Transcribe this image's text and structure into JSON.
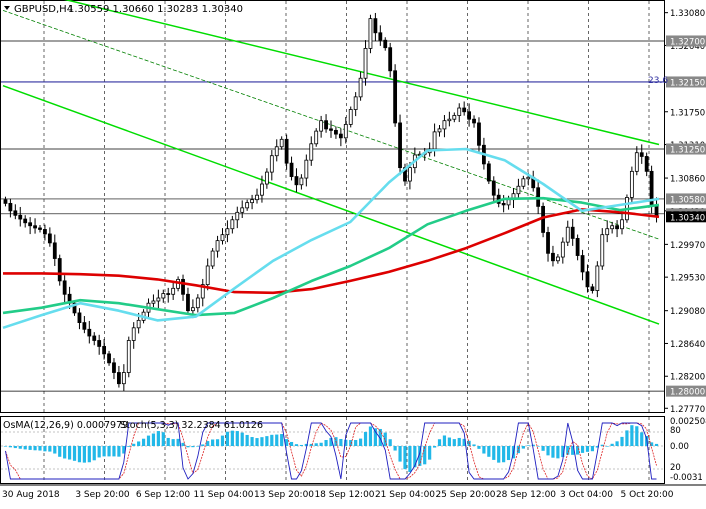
{
  "header": {
    "symbol": "GBPUSD,H4",
    "ohlc": "1.30559 1.30660 1.30283 1.30340"
  },
  "oscillator_header": {
    "osma_label": "OsMA(12,26,9) 0.0007979",
    "stoch_label": "Stoch(5,3,3) 32.2384 61.0126"
  },
  "price_axis": {
    "ticks": [
      "1.33080",
      "1.32640",
      "1.32150",
      "1.31750",
      "1.31310",
      "1.30860",
      "1.30420",
      "1.29970",
      "1.29530",
      "1.29080",
      "1.28640",
      "1.28200",
      "1.27770"
    ],
    "highlighted": [
      {
        "text": "1.32700",
        "value": 1.327,
        "kind": "level"
      },
      {
        "text": "1.32150",
        "value": 1.3215,
        "kind": "level-blue"
      },
      {
        "text": "1.31250",
        "value": 1.3125,
        "kind": "level"
      },
      {
        "text": "1.30580",
        "value": 1.3058,
        "kind": "level"
      },
      {
        "text": "1.30380",
        "value": 1.3038,
        "kind": "level"
      },
      {
        "text": "1.30340",
        "value": 1.3034,
        "kind": "current"
      },
      {
        "text": "1.28000",
        "value": 1.28,
        "kind": "level"
      }
    ],
    "fib_label": "23.6"
  },
  "osc_axis": {
    "ticks": [
      "0.002508",
      "80",
      "0.00",
      "20",
      "-0.0031"
    ]
  },
  "time_axis": {
    "labels": [
      "30 Aug 2018",
      "3 Sep 20:00",
      "6 Sep 12:00",
      "11 Sep 04:00",
      "13 Sep 20:00",
      "18 Sep 12:00",
      "21 Sep 04:00",
      "25 Sep 20:00",
      "28 Sep 12:00",
      "3 Oct 04:00",
      "5 Oct 20:00"
    ]
  },
  "colors": {
    "background": "#ffffff",
    "candle": "#000000",
    "channel": "#00dd00",
    "thin_channel": "#008000",
    "ema200": "#dd0000",
    "ema144": "#22cc88",
    "ema50": "#66ddee",
    "osma_hist": "#22b8e8",
    "stoch_main": "#1f1fbf",
    "stoch_signal": "#dd2222",
    "grid": "#000000",
    "level_blue": "#3030a0"
  },
  "chart_data": {
    "type": "candlestick",
    "title": "GBPUSD,H4",
    "ylim": [
      1.2772,
      1.3325
    ],
    "close_series": [
      1.3052,
      1.3042,
      1.3036,
      1.3031,
      1.3026,
      1.3022,
      1.3019,
      1.3017,
      1.3011,
      1.2999,
      1.2978,
      1.2948,
      1.293,
      1.2918,
      1.2905,
      1.2892,
      1.2883,
      1.2874,
      1.2868,
      1.286,
      1.285,
      1.2838,
      1.2825,
      1.281,
      1.2825,
      1.2868,
      1.2885,
      1.2895,
      1.2906,
      1.2918,
      1.2921,
      1.2925,
      1.2931,
      1.293,
      1.2938,
      1.295,
      1.293,
      1.2908,
      1.2912,
      1.2925,
      1.2943,
      1.2968,
      1.2988,
      1.3002,
      1.301,
      1.3018,
      1.303,
      1.304,
      1.3046,
      1.3053,
      1.3057,
      1.3063,
      1.3078,
      1.3094,
      1.3116,
      1.3128,
      1.3138,
      1.3106,
      1.3088,
      1.3077,
      1.3086,
      1.311,
      1.3132,
      1.3149,
      1.3163,
      1.3152,
      1.315,
      1.3145,
      1.314,
      1.3158,
      1.3178,
      1.3195,
      1.322,
      1.326,
      1.33,
      1.3281,
      1.3271,
      1.3261,
      1.323,
      1.316,
      1.31,
      1.3082,
      1.31,
      1.3117,
      1.3118,
      1.312,
      1.3125,
      1.3148,
      1.3152,
      1.3163,
      1.3165,
      1.317,
      1.318,
      1.3175,
      1.3165,
      1.316,
      1.313,
      1.3105,
      1.3082,
      1.3063,
      1.3052,
      1.305,
      1.3057,
      1.3065,
      1.3075,
      1.3085,
      1.3087,
      1.3073,
      1.3048,
      1.3013,
      1.2985,
      1.2975,
      1.298,
      1.3,
      1.302,
      1.3005,
      1.2982,
      1.296,
      1.294,
      1.2935,
      1.2968,
      1.301,
      1.3018,
      1.3022,
      1.3018,
      1.303,
      1.306,
      1.3095,
      1.312,
      1.3115,
      1.3095,
      1.305,
      1.3034
    ],
    "series": [
      {
        "name": "EMA200",
        "values": [
          1.2958,
          1.2958,
          1.2957,
          1.2955,
          1.295,
          1.2942,
          1.2933,
          1.2932,
          1.2937,
          1.2948,
          1.296,
          1.2975,
          1.2992,
          1.3012,
          1.3033,
          1.3044,
          1.304,
          1.3034
        ]
      },
      {
        "name": "EMA144",
        "values": [
          1.2905,
          1.2912,
          1.2922,
          1.2918,
          1.291,
          1.2902,
          1.2905,
          1.2925,
          1.2948,
          1.2968,
          1.2992,
          1.3024,
          1.3042,
          1.3058,
          1.3059,
          1.3053,
          1.3043,
          1.305
        ]
      },
      {
        "name": "EMA50",
        "values": [
          1.2885,
          1.2902,
          1.2918,
          1.2908,
          1.2895,
          1.29,
          1.2938,
          1.2975,
          1.3003,
          1.3027,
          1.308,
          1.3123,
          1.3125,
          1.311,
          1.3078,
          1.3042,
          1.305,
          1.3058
        ]
      }
    ],
    "channels": [
      {
        "name": "upper-channel",
        "from": [
          0,
          1.3346
        ],
        "to": [
          1,
          1.3131
        ]
      },
      {
        "name": "lower-channel",
        "from": [
          0,
          1.321
        ],
        "to": [
          1,
          1.289
        ]
      },
      {
        "name": "thin-channel",
        "from": [
          0,
          1.3311
        ],
        "to": [
          1,
          1.3004
        ]
      }
    ]
  }
}
